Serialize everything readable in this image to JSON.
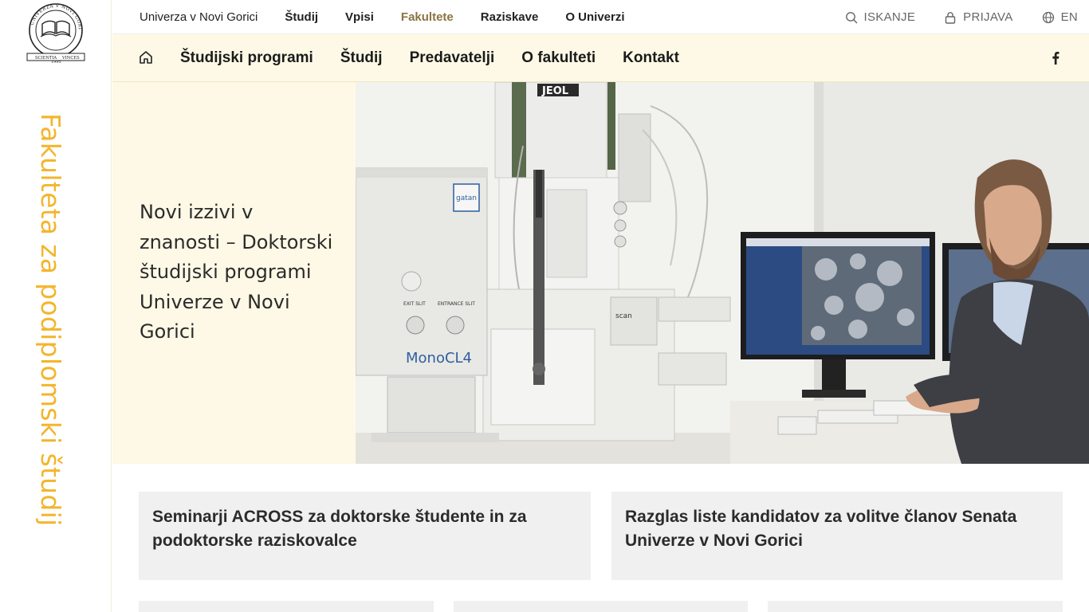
{
  "rail": {
    "logo_text": {
      "top": "UNIVERZA V NOVI GORICI",
      "bottom": "SCIENTIA",
      "bottom2": "VINCES",
      "year": "1995"
    },
    "title": "Fakulteta za podiplomski študij"
  },
  "top_nav": {
    "links": [
      "Univerza v Novi Gorici",
      "Študij",
      "Vpisi",
      "Fakultete",
      "Raziskave",
      "O Univerzi"
    ],
    "active": "Fakultete",
    "search_label": "ISKANJE",
    "login_label": "PRIJAVA",
    "lang_label": "EN"
  },
  "faculty_nav": {
    "items": [
      "Študijski programi",
      "Študij",
      "Predavatelji",
      "O fakulteti",
      "Kontakt"
    ]
  },
  "hero": {
    "title": "Novi izzivi v znanosti – Doktorski študijski programi Univerze v Novi Gorici",
    "image": {
      "instrument_brand": "JEOL",
      "detector_label": "MonoCL4",
      "vendor_badge": "gatan",
      "knob_left": "EXIT SLIT",
      "knob_right": "ENTRANCE SLIT",
      "scan_label": "scan"
    }
  },
  "news": [
    {
      "title": "Seminarji ACROSS za doktorske študente in za podoktorske raziskovalce"
    },
    {
      "title": "Razglas liste kandidatov za volitve članov Senata Univerze v Novi Gorici"
    },
    {
      "title": ""
    },
    {
      "title": ""
    },
    {
      "title": ""
    }
  ],
  "colors": {
    "accent_yellow": "#f3b52c",
    "panel_cream": "#fef9e6",
    "active_link": "#8a7440",
    "card_gray": "#f0f0f0"
  },
  "icons": [
    "search-icon",
    "lock-icon",
    "globe-icon",
    "home-icon",
    "facebook-icon"
  ]
}
